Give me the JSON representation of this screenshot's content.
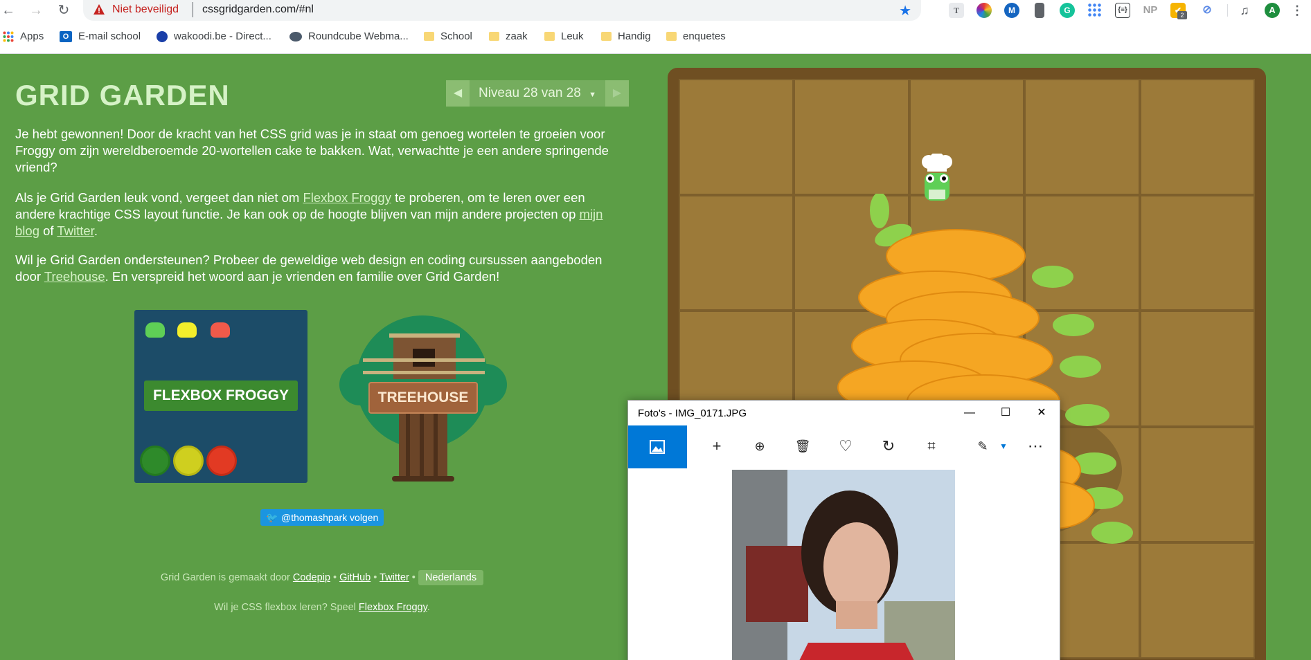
{
  "browser": {
    "security_label": "Niet beveiligd",
    "url": "cssgridgarden.com/#nl",
    "extensions": [
      {
        "name": "T",
        "color": "#5f6368"
      },
      {
        "name": "color-wheel",
        "color": "#e53935"
      },
      {
        "name": "M",
        "color": "#1565c0"
      },
      {
        "name": "bookmark-ext",
        "color": "#5f6368"
      },
      {
        "name": "G",
        "color": "#15c39a"
      },
      {
        "name": "grid-dots",
        "color": "#4285f4"
      },
      {
        "name": "{≡}",
        "color": "#3c4043"
      },
      {
        "name": "NP",
        "color": "#9e9e9e"
      },
      {
        "name": "todo",
        "color": "#f6b400"
      },
      {
        "name": "eye-slash",
        "color": "#5c8ae6"
      },
      {
        "name": "media",
        "color": "#5f6368"
      },
      {
        "name": "A",
        "color": "#1e8e3e"
      }
    ],
    "ext_badge": "2",
    "profile_initial": "A"
  },
  "bookmarks": [
    {
      "label": "Apps",
      "icon": "apps-grid-icon"
    },
    {
      "label": "E-mail school",
      "icon": "outlook-icon"
    },
    {
      "label": "wakoodi.be - Direct...",
      "icon": "wakoodi-icon"
    },
    {
      "label": "Roundcube Webma...",
      "icon": "roundcube-icon"
    },
    {
      "label": "School",
      "icon": "folder-icon"
    },
    {
      "label": "zaak",
      "icon": "folder-icon"
    },
    {
      "label": "Leuk",
      "icon": "folder-icon"
    },
    {
      "label": "Handig",
      "icon": "folder-icon"
    },
    {
      "label": "enquetes",
      "icon": "folder-icon"
    }
  ],
  "page": {
    "title": "GRID GARDEN",
    "level_label": "Niveau 28 van 28",
    "p1": "Je hebt gewonnen! Door de kracht van het CSS grid was je in staat om genoeg wortelen te groeien voor Froggy om zijn wereldberoemde 20-wortellen cake te bakken. Wat, verwachtte je een andere springende vriend?",
    "p2_a": "Als je Grid Garden leuk vond, vergeet dan niet om ",
    "p2_link1": "Flexbox Froggy",
    "p2_b": " te proberen, om te leren over een andere krachtige CSS layout functie. Je kan ook op de hoogte blijven van mijn andere projecten op ",
    "p2_link2": "mijn blog",
    "p2_c": " of ",
    "p2_link3": "Twitter",
    "p2_d": ".",
    "p3_a": "Wil je Grid Garden ondersteunen? Probeer de geweldige web design en coding cursussen aangeboden door ",
    "p3_link": "Treehouse",
    "p3_b": ". En verspreid het woord aan je vrienden en familie over Grid Garden!",
    "flexbox_card_label": "FLEXBOX FROGGY",
    "treehouse_label": "TREEHOUSE",
    "twitter_follow": "@thomashpark volgen",
    "footer1_a": "Grid Garden is gemaakt door ",
    "footer1_codepip": "Codepip",
    "footer1_sep": " • ",
    "footer1_github": "GitHub",
    "footer1_twitter": "Twitter",
    "footer1_lang": "Nederlands",
    "footer2_a": "Wil je CSS flexbox leren? Speel ",
    "footer2_link": "Flexbox Froggy",
    "footer2_b": "."
  },
  "photos_window": {
    "title": "Foto's - IMG_0171.JPG",
    "tools": [
      "image-icon",
      "plus-icon",
      "zoom-in-icon",
      "trash-icon",
      "heart-icon",
      "rotate-icon",
      "crop-icon",
      "edit-icon",
      "more-icon"
    ]
  },
  "colors": {
    "page_bg": "#5c9e46",
    "title": "#d6f2c7",
    "soil": "#9c7a39",
    "carrot": "#f5a623",
    "leaf": "#8ed14c"
  }
}
